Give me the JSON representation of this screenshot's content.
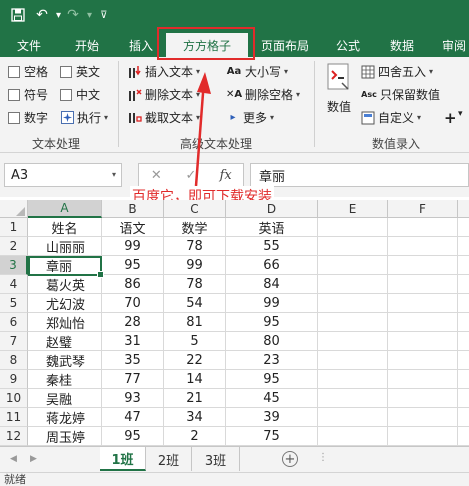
{
  "colors": {
    "accent": "#217346",
    "annotation": "#e12b2b"
  },
  "titlebar": {
    "icons": [
      "save-icon",
      "undo-icon",
      "redo-icon"
    ]
  },
  "tabs": [
    {
      "label": "文件"
    },
    {
      "label": "开始"
    },
    {
      "label": "插入"
    },
    {
      "label": "方方格子"
    },
    {
      "label": "页面布局"
    },
    {
      "label": "公式"
    },
    {
      "label": "数据"
    },
    {
      "label": "审阅"
    }
  ],
  "ribbon": {
    "text_group": {
      "checkboxes": [
        "空格",
        "英文",
        "符号",
        "中文",
        "数字"
      ],
      "execute": "执行",
      "label": "文本处理"
    },
    "advanced_group": {
      "insert_text": "插入文本",
      "delete_text": "删除文本",
      "cut_text": "截取文本",
      "case": "大小写",
      "delete_space": "删除空格",
      "more": "更多",
      "label": "高级文本处理"
    },
    "number_group": {
      "value": "数值",
      "round": "四舍五入",
      "keep_value": "只保留数值",
      "custom": "自定义",
      "label": "数值录入"
    }
  },
  "formula_bar": {
    "cell_ref": "A3",
    "cancel": "✕",
    "confirm": "✓",
    "fx": "fx",
    "content": "章丽"
  },
  "annotation": "百度它，即可下载安装",
  "grid": {
    "columns": [
      "A",
      "B",
      "C",
      "D",
      "E",
      "F"
    ],
    "rows": [
      {
        "n": "1",
        "cells": [
          "姓名",
          "语文",
          "数学",
          "英语"
        ]
      },
      {
        "n": "2",
        "cells": [
          "山丽丽",
          "99",
          "78",
          "55"
        ]
      },
      {
        "n": "3",
        "cells": [
          "章丽",
          "95",
          "99",
          "66"
        ]
      },
      {
        "n": "4",
        "cells": [
          "葛火英",
          "86",
          "78",
          "84"
        ]
      },
      {
        "n": "5",
        "cells": [
          "尤幻波",
          "70",
          "54",
          "99"
        ]
      },
      {
        "n": "6",
        "cells": [
          "郑灿怡",
          "28",
          "81",
          "95"
        ]
      },
      {
        "n": "7",
        "cells": [
          "赵璧",
          "31",
          "5",
          "80"
        ]
      },
      {
        "n": "8",
        "cells": [
          "魏武琴",
          "35",
          "22",
          "23"
        ]
      },
      {
        "n": "9",
        "cells": [
          "秦桂",
          "77",
          "14",
          "95"
        ]
      },
      {
        "n": "10",
        "cells": [
          "吴融",
          "93",
          "21",
          "45"
        ]
      },
      {
        "n": "11",
        "cells": [
          "蒋龙婷",
          "47",
          "34",
          "39"
        ]
      },
      {
        "n": "12",
        "cells": [
          "周玉婷",
          "95",
          "2",
          "75"
        ]
      }
    ]
  },
  "sheets": [
    "1班",
    "2班",
    "3班"
  ],
  "add_sheet": "+",
  "status": "就绪"
}
